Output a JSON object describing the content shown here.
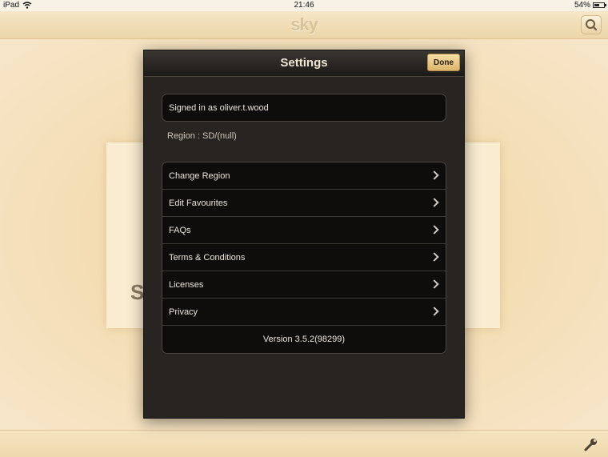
{
  "status_bar": {
    "device": "iPad",
    "time": "21:46",
    "battery": "54%"
  },
  "header": {
    "logo": "sky",
    "search_icon": "search-icon"
  },
  "background": {
    "letter": "S"
  },
  "settings": {
    "title": "Settings",
    "done_label": "Done",
    "signed_in": "Signed in as oliver.t.wood",
    "region": "Region : SD/(null)",
    "items": [
      {
        "label": "Change Region"
      },
      {
        "label": "Edit Favourites"
      },
      {
        "label": "FAQs"
      },
      {
        "label": "Terms & Conditions"
      },
      {
        "label": "Licenses"
      },
      {
        "label": "Privacy"
      }
    ],
    "version": "Version 3.5.2(98299)"
  },
  "footer": {
    "tools_icon": "wrench-icon"
  }
}
